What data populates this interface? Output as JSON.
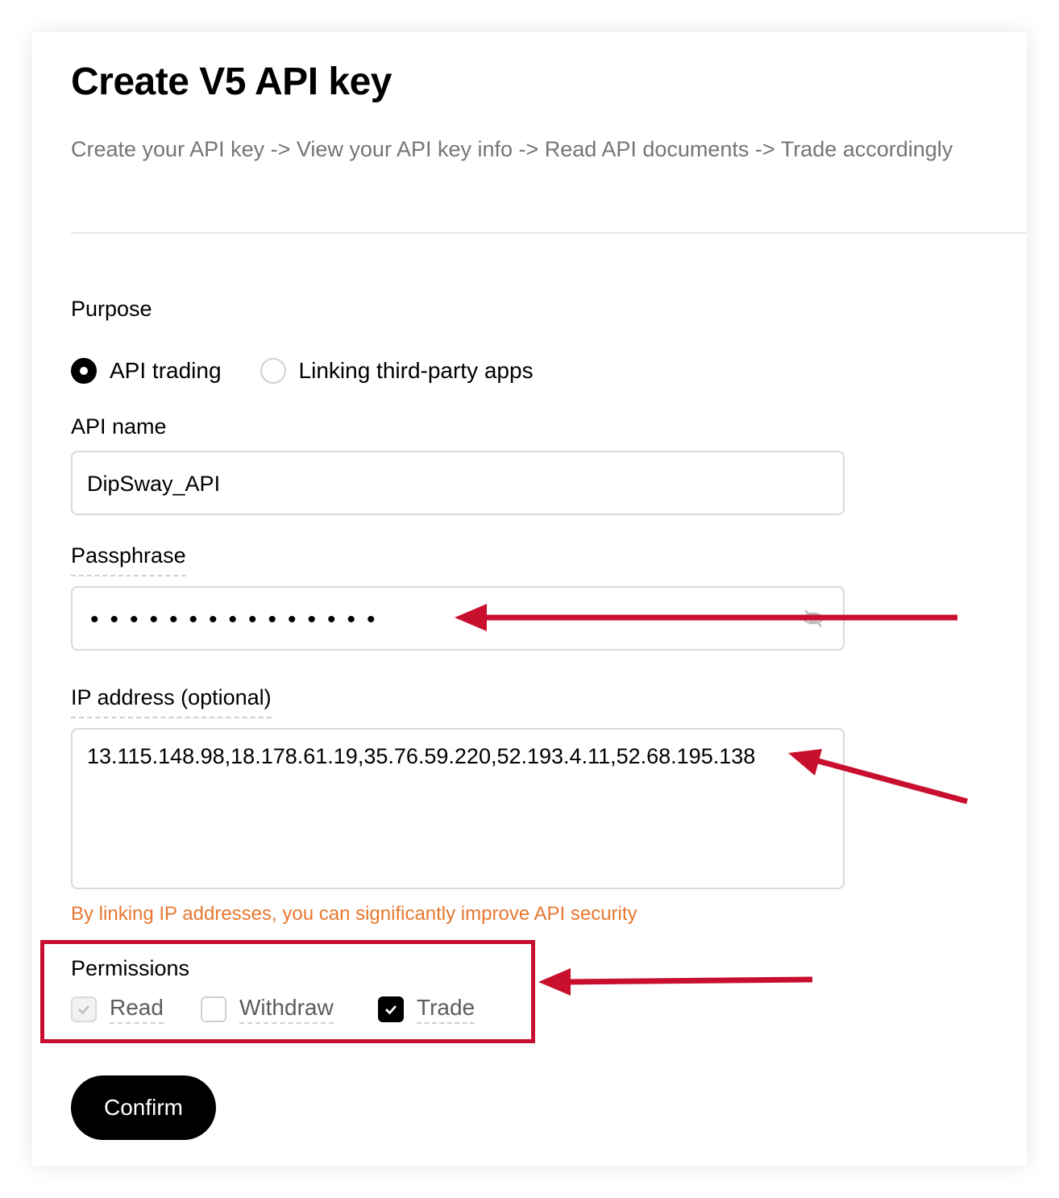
{
  "header": {
    "title": "Create V5 API key",
    "subtitle": "Create your API key -> View your API key info -> Read API documents -> Trade accordingly"
  },
  "purpose": {
    "label": "Purpose",
    "options": [
      {
        "label": "API trading",
        "selected": true
      },
      {
        "label": "Linking third-party apps",
        "selected": false
      }
    ]
  },
  "api_name": {
    "label": "API name",
    "value": "DipSway_API"
  },
  "passphrase": {
    "label": "Passphrase",
    "masked_value": "•••••••••••••••",
    "visibility_icon": "eye-off-icon"
  },
  "ip_address": {
    "label": "IP address (optional)",
    "value": "13.115.148.98,18.178.61.19,35.76.59.220,52.193.4.11,52.68.195.138",
    "hint": "By linking IP addresses, you can significantly improve API security"
  },
  "permissions": {
    "label": "Permissions",
    "items": [
      {
        "label": "Read",
        "checked": true,
        "disabled": true
      },
      {
        "label": "Withdraw",
        "checked": false,
        "disabled": false
      },
      {
        "label": "Trade",
        "checked": true,
        "disabled": false
      }
    ]
  },
  "actions": {
    "confirm_label": "Confirm"
  },
  "colors": {
    "annotation_red": "#c8102e",
    "hint_orange": "#e8772e",
    "primary": "#000000"
  }
}
